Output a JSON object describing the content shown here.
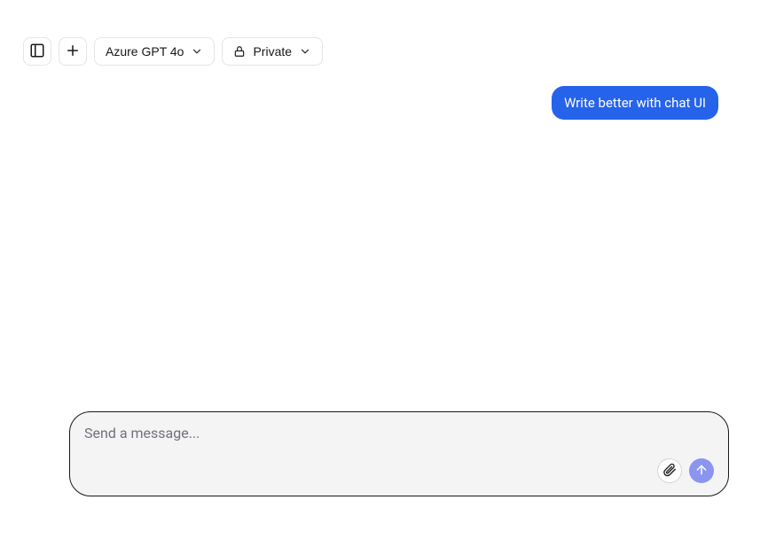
{
  "toolbar": {
    "model_selector": "Azure GPT 4o",
    "visibility": "Private"
  },
  "messages": {
    "user_0": "Write better with chat UI"
  },
  "composer": {
    "placeholder": "Send a message..."
  }
}
